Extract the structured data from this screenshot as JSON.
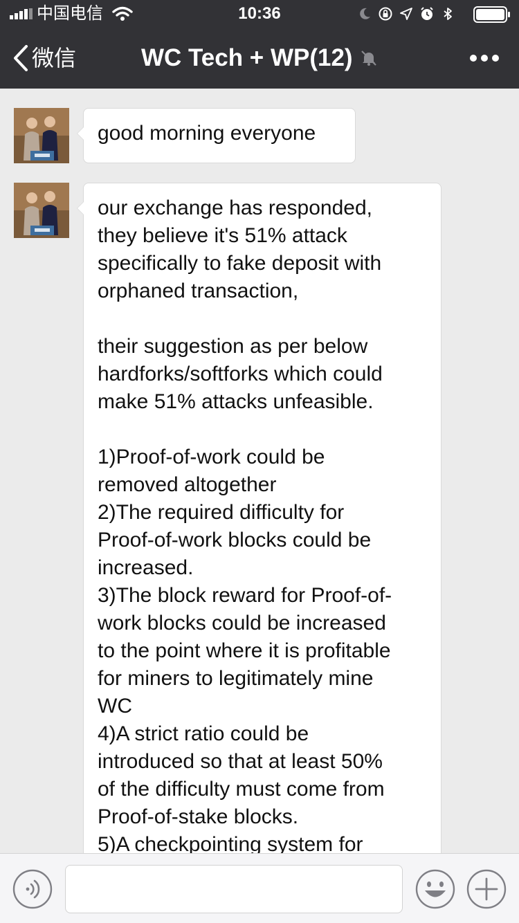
{
  "status_bar": {
    "carrier": "中国电信",
    "time": "10:36"
  },
  "nav": {
    "back_label": "微信",
    "title": "WC Tech + WP(12)"
  },
  "messages": [
    {
      "text": "good morning everyone"
    },
    {
      "text": "our exchange has responded,\nthey believe it's 51% attack\nspecifically to fake deposit with\norphaned transaction,\n\ntheir suggestion as per below\nhardforks/softforks which could\nmake 51% attacks unfeasible.\n\n1)Proof-of-work could be\nremoved altogether\n2)The required difficulty for\nProof-of-work blocks could be\nincreased.\n3)The block reward for Proof-of-\nwork blocks could be increased\nto the point where it is profitable\nfor miners to legitimately mine\nWC\n4)A strict ratio could be\nintroduced so that at least 50%\nof the difficulty must come from\nProof-of-stake blocks.\n5)A checkpointing system for"
    }
  ],
  "icons": {
    "back": "chevron-left-icon",
    "mute": "mute-bell-icon",
    "more": "more-dots-icon",
    "voice": "voice-icon",
    "emoji": "emoji-icon",
    "plus": "plus-icon"
  },
  "colors": {
    "nav_background": "#323236",
    "chat_background": "#ebebeb",
    "bubble_background": "#ffffff",
    "input_bar_background": "#f5f5f7"
  }
}
